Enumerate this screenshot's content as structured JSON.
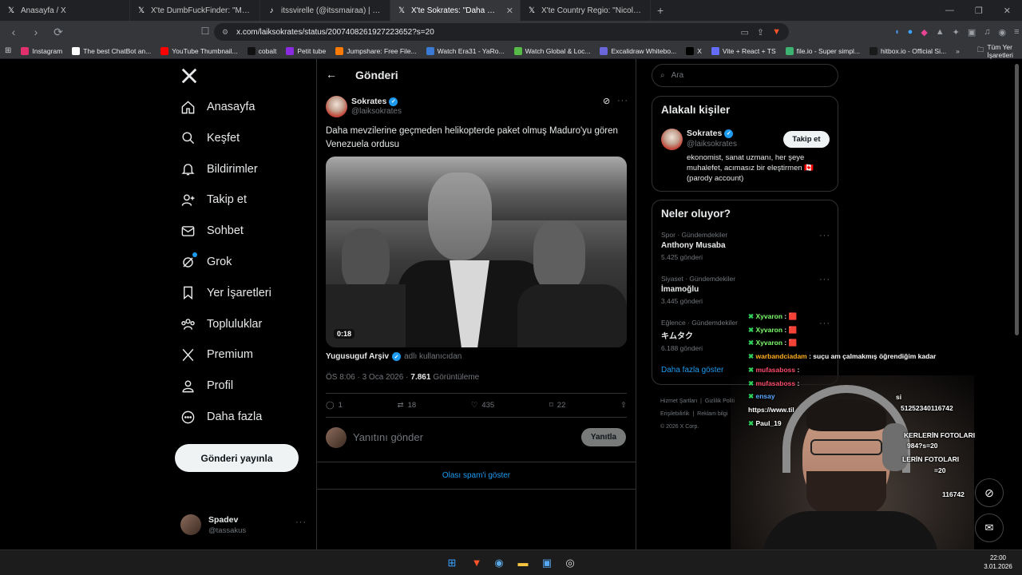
{
  "browser": {
    "tabs": [
      {
        "icon": "x-logo-icon",
        "title": "Anasayfa / X"
      },
      {
        "icon": "x-logo-icon",
        "title": "X'te DumbFuckFinder: \"More footag"
      },
      {
        "icon": "tiktok-icon",
        "title": "itssvirelle (@itssmairaa) | TikTok"
      },
      {
        "icon": "x-logo-icon",
        "title": "X'te Sokrates: \"Daha mevzilerine",
        "active": true
      },
      {
        "icon": "x-logo-icon",
        "title": "X'te Country Regio: \"Nicolás maduro"
      }
    ],
    "url": "x.com/laiksokrates/status/2007408261927223652?s=20",
    "bookmarks": [
      {
        "label": "Instagram",
        "color": "#e1306c"
      },
      {
        "label": "The best ChatBot an...",
        "color": "#ffffff"
      },
      {
        "label": "YouTube Thumbnail...",
        "color": "#ff0000"
      },
      {
        "label": "cobalt",
        "color": "#111111"
      },
      {
        "label": "Petit tube",
        "color": "#8a2be2"
      },
      {
        "label": "Jumpshare: Free File...",
        "color": "#ff7a00"
      },
      {
        "label": "Watch Era31 - YaRo...",
        "color": "#3a7bd5"
      },
      {
        "label": "Watch Global & Loc...",
        "color": "#57b947"
      },
      {
        "label": "Excalidraw Whitebo...",
        "color": "#6965db"
      },
      {
        "label": "X",
        "color": "#000000"
      },
      {
        "label": "Vite + React + TS",
        "color": "#646cff"
      },
      {
        "label": "file.io - Super simpl...",
        "color": "#3cb371"
      },
      {
        "label": "hitbox.io - Official Si...",
        "color": "#1a1a1a"
      }
    ],
    "all_bookmarks": "Tüm Yer İşaretleri"
  },
  "sidebar": {
    "items": [
      {
        "label": "Anasayfa",
        "icon": "home-icon"
      },
      {
        "label": "Keşfet",
        "icon": "search-icon"
      },
      {
        "label": "Bildirimler",
        "icon": "bell-icon"
      },
      {
        "label": "Takip et",
        "icon": "add-user-icon"
      },
      {
        "label": "Sohbet",
        "icon": "mail-icon"
      },
      {
        "label": "Grok",
        "icon": "grok-icon"
      },
      {
        "label": "Yer İşaretleri",
        "icon": "bookmark-icon"
      },
      {
        "label": "Topluluklar",
        "icon": "communities-icon"
      },
      {
        "label": "Premium",
        "icon": "x-logo-icon"
      },
      {
        "label": "Profil",
        "icon": "profile-icon"
      },
      {
        "label": "Daha fazla",
        "icon": "more-circle-icon"
      }
    ],
    "post_button": "Gönderi yayınla",
    "account": {
      "name": "Spadev",
      "handle": "@tassakus"
    }
  },
  "post": {
    "header": "Gönderi",
    "author_name": "Sokrates",
    "author_handle": "@laiksokrates",
    "text": "Daha mevzilerine geçmeden helikopterde paket olmuş Maduro'yu gören Venezuela ordusu",
    "video_duration": "0:18",
    "attribution_user": "Yugusuguf Arşiv",
    "attribution_suffix": "adlı kullanıcıdan",
    "time": "ÖS 8:06 · 3 Oca 2026 ·",
    "views": "7.861",
    "views_label": "Görüntüleme",
    "stats": {
      "replies": "1",
      "reposts": "18",
      "likes": "435",
      "bookmarks": "22"
    },
    "reply_placeholder": "Yanıtını gönder",
    "reply_button": "Yanıtla",
    "spam_link": "Olası spam'i göster"
  },
  "right": {
    "search_placeholder": "Ara",
    "relevant": {
      "title": "Alakalı kişiler",
      "name": "Sokrates",
      "handle": "@laiksokrates",
      "follow": "Takip et",
      "bio": "ekonomist, sanat uzmanı, her şeye muhalefet, acımasız bir eleştirmen 🇨🇦 (parody account)"
    },
    "trends": {
      "title": "Neler oluyor?",
      "items": [
        {
          "category": "Spor · Gündemdekiler",
          "name": "Anthony Musaba",
          "count": "5.425 gönderi"
        },
        {
          "category": "Siyaset · Gündemdekiler",
          "name": "İmamoğlu",
          "count": "3.445 gönderi"
        },
        {
          "category": "Eğlence · Gündemdekiler",
          "name": "キムタク",
          "count": "6.188 gönderi"
        }
      ],
      "more": "Daha fazla göster"
    },
    "footer": [
      "Hizmet Şartları",
      "Gizlilik Politi",
      "Erişilebilirlik",
      "Reklam bilgi",
      "© 2026 X Corp."
    ]
  },
  "chat": [
    {
      "user": "Xyvaron",
      "msg": ": 🟥",
      "color": "#7dff6d"
    },
    {
      "user": "Xyvaron",
      "msg": ": 🟥",
      "color": "#7dff6d"
    },
    {
      "user": "Xyvaron",
      "msg": ": 🟥",
      "color": "#7dff6d"
    },
    {
      "user": "warbandciadam",
      "msg": ": suçu am çalmakmış öğrendiğim kadar",
      "color": "#ffb020"
    },
    {
      "user": "mufasaboss",
      "msg": ":",
      "color": "#ff4d6d"
    },
    {
      "user": "mufasaboss",
      "msg": ":",
      "color": "#ff4d6d"
    },
    {
      "user": "ensay",
      "msg": "",
      "color": "#5aa9ff"
    },
    {
      "user": "",
      "msg": "https://www.til",
      "color": "#ffffff"
    },
    {
      "user": "Paul_19",
      "msg": "",
      "color": "#ffffff"
    }
  ],
  "chat_right_fragments": [
    "si",
    "51252340116742",
    "KERLERİN FOTOLARI",
    "984?s=20",
    "LERİN FOTOLARI",
    "=20",
    "116742"
  ],
  "taskbar": {
    "time": "22:00",
    "date": "3.01.2026"
  }
}
